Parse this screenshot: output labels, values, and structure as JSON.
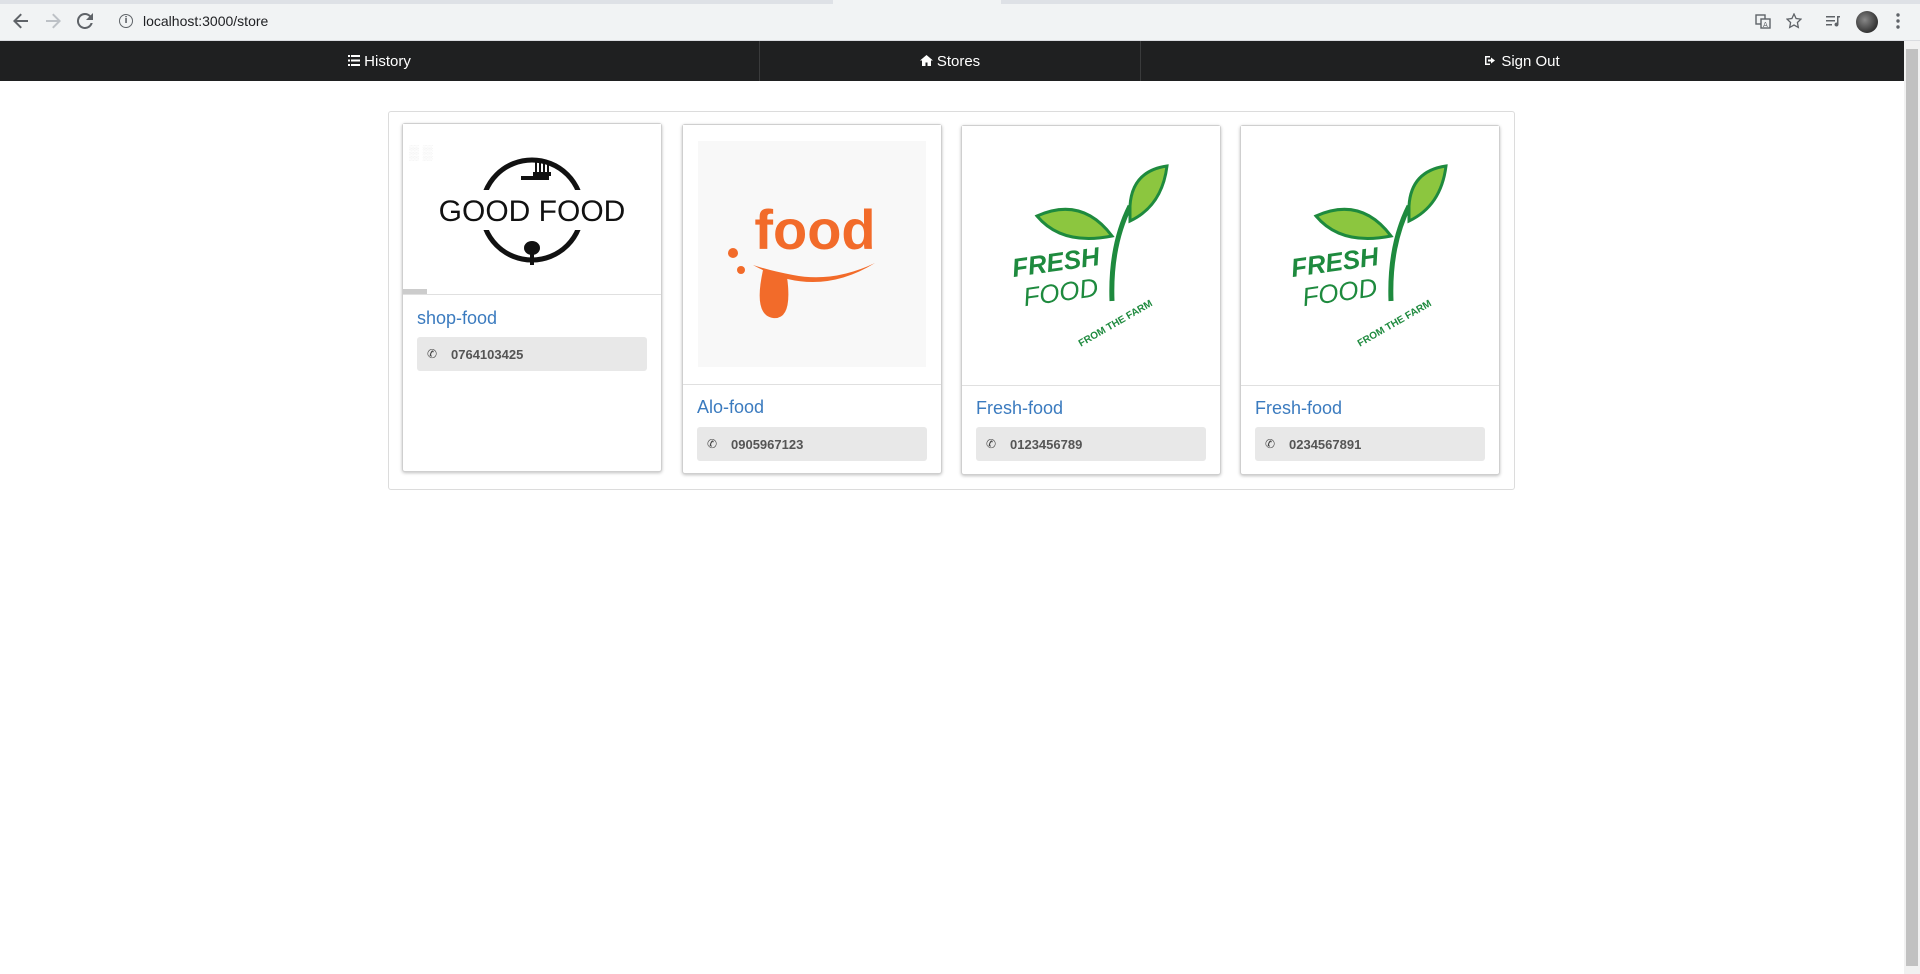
{
  "browser": {
    "url": "localhost:3000/store",
    "back_icon": "arrow-left-icon",
    "forward_icon": "arrow-right-icon",
    "reload_icon": "reload-icon"
  },
  "navbar": {
    "items": [
      {
        "label": "History",
        "icon": "list-icon"
      },
      {
        "label": "Stores",
        "icon": "home-icon"
      },
      {
        "label": "Sign Out",
        "icon": "sign-out-icon"
      }
    ]
  },
  "stores": [
    {
      "name": "shop-food",
      "phone": "0764103425",
      "logo": "good-food-logo",
      "logo_text": "GOOD FOOD"
    },
    {
      "name": "Alo-food",
      "phone": "0905967123",
      "logo": "food-logo",
      "logo_text": "food"
    },
    {
      "name": "Fresh-food",
      "phone": "0123456789",
      "logo": "fresh-food-logo",
      "logo_text": "FRESH FOOD",
      "logo_subtext": "FROM THE FARM"
    },
    {
      "name": "Fresh-food",
      "phone": "0234567891",
      "logo": "fresh-food-logo",
      "logo_text": "FRESH FOOD",
      "logo_subtext": "FROM THE FARM"
    }
  ],
  "colors": {
    "navbar_bg": "#1f2021",
    "store_name": "#3b7bbf",
    "food_orange": "#f26b2a",
    "fresh_green": "#1e8a3e",
    "leaf_green": "#8cc63f"
  }
}
